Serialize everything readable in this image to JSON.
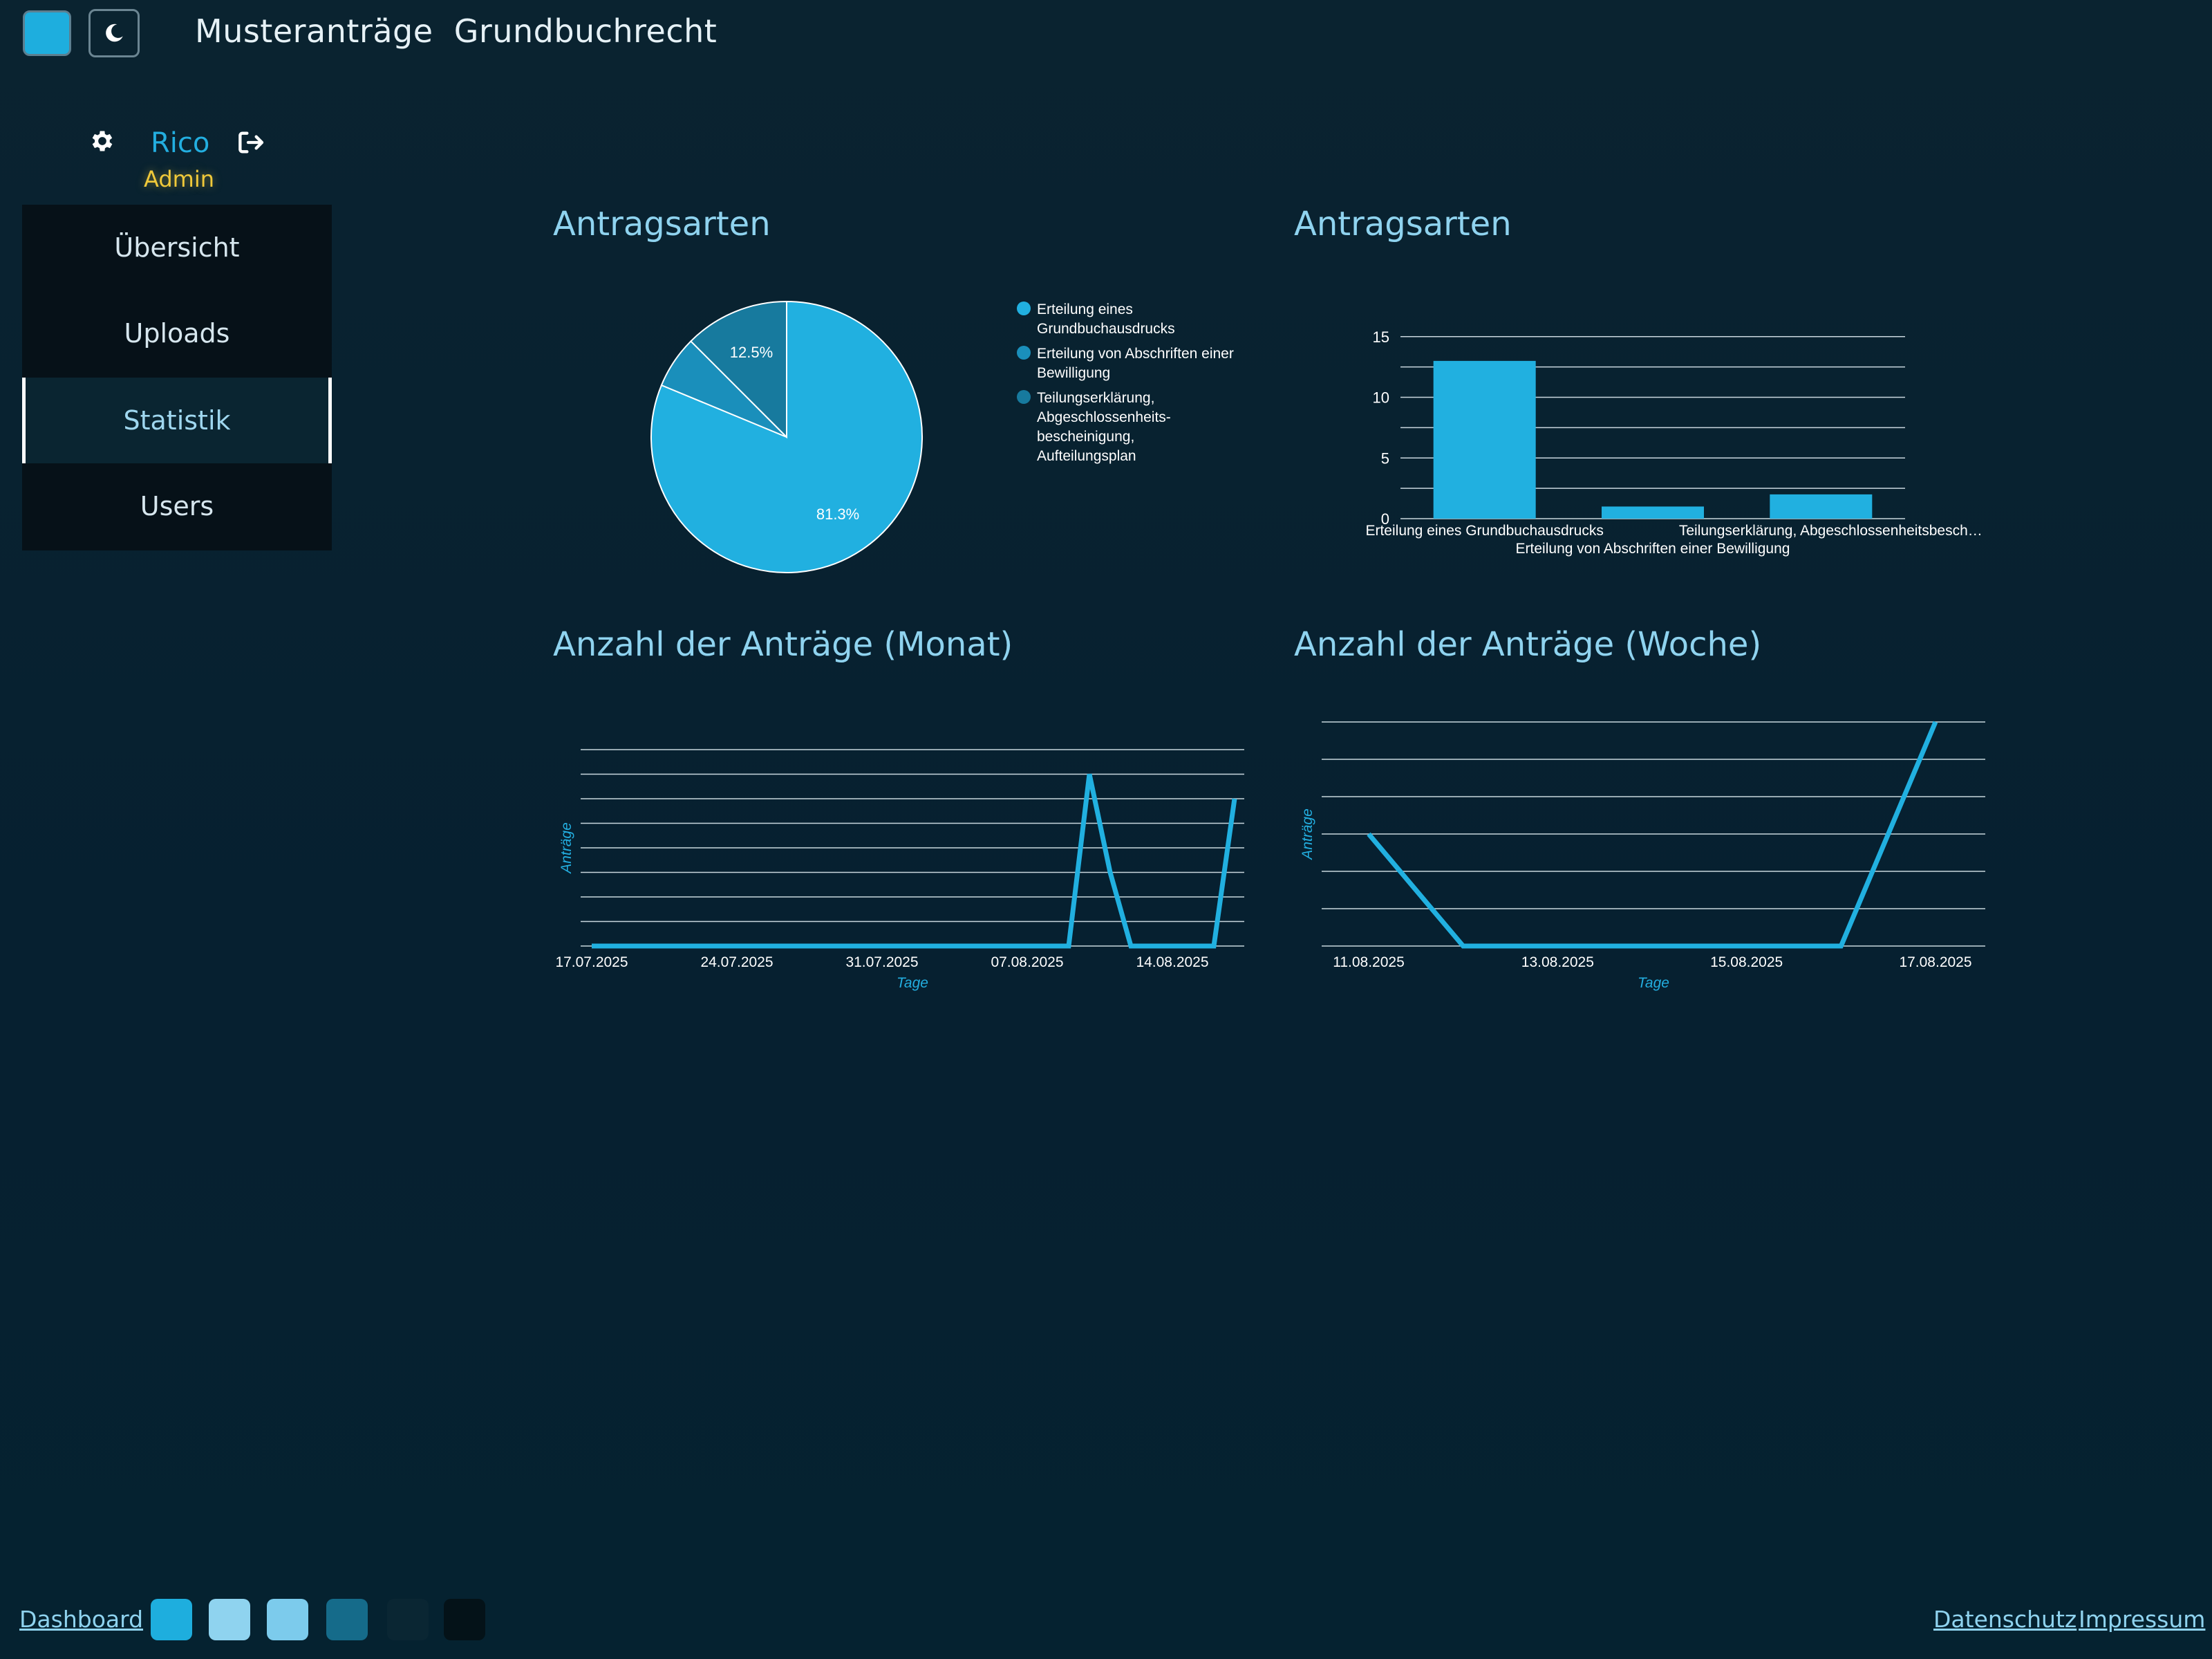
{
  "header": {
    "title": "Musteranträge  Grundbuchrecht",
    "theme_square_color": "#1eaede",
    "moon_icon": "moon-icon"
  },
  "user": {
    "name": "Rico",
    "role": "Admin",
    "settings_icon": "gear-icon",
    "logout_icon": "logout-icon"
  },
  "sidebar": {
    "items": [
      {
        "label": "Übersicht",
        "active": false
      },
      {
        "label": "Uploads",
        "active": false
      },
      {
        "label": "Statistik",
        "active": true
      },
      {
        "label": "Users",
        "active": false
      }
    ]
  },
  "panels": {
    "pie_title": "Antragsarten",
    "bar_title": "Antragsarten",
    "month_title": "Anzahl der Anträge (Monat)",
    "week_title": "Anzahl der Anträge (Woche)"
  },
  "chart_data": [
    {
      "type": "pie",
      "title": "Antragsarten",
      "categories": [
        "Erteilung eines Grundbuchausdrucks",
        "Erteilung von Abschriften einer Bewilligung",
        "Teilungserklärung, Abgeschlossenheits-bescheinigung, Aufteilungsplan"
      ],
      "legend_lines": [
        [
          "Erteilung eines",
          "Grundbuchausdrucks"
        ],
        [
          "Erteilung von Abschriften einer",
          "Bewilligung"
        ],
        [
          "Teilungserklärung,",
          "Abgeschlossenheits-",
          "bescheinigung,",
          "Aufteilungsplan"
        ]
      ],
      "values": [
        81.25,
        6.25,
        12.5
      ],
      "data_labels": [
        "81.3%",
        "",
        "12.5%"
      ],
      "colors": [
        "#21b0e0",
        "#1a8fbb",
        "#177a9e"
      ],
      "legend": "right"
    },
    {
      "type": "bar",
      "title": "Antragsarten",
      "categories": [
        "Erteilung eines Grundbuchausdrucks",
        "Erteilung von Abschriften einer Bewilligung",
        "Teilungserklärung, Abgeschlossenheitsbesch…"
      ],
      "values": [
        13,
        1,
        2
      ],
      "yticks": [
        0,
        5,
        10,
        15
      ],
      "ylim": [
        0,
        15.5
      ],
      "grid": true,
      "color": "#21b0e0"
    },
    {
      "type": "line",
      "title": "Anzahl der Anträge (Monat)",
      "xlabel": "Tage",
      "ylabel": "Anträge",
      "xticks": [
        "17.07.2025",
        "24.07.2025",
        "31.07.2025",
        "07.08.2025",
        "14.08.2025"
      ],
      "x": [
        "17.07.2025",
        "18.07.2025",
        "19.07.2025",
        "20.07.2025",
        "21.07.2025",
        "22.07.2025",
        "23.07.2025",
        "24.07.2025",
        "25.07.2025",
        "26.07.2025",
        "27.07.2025",
        "28.07.2025",
        "29.07.2025",
        "30.07.2025",
        "31.07.2025",
        "01.08.2025",
        "02.08.2025",
        "03.08.2025",
        "04.08.2025",
        "05.08.2025",
        "06.08.2025",
        "07.08.2025",
        "08.08.2025",
        "09.08.2025",
        "10.08.2025",
        "11.08.2025",
        "12.08.2025",
        "13.08.2025",
        "14.08.2025",
        "15.08.2025",
        "16.08.2025",
        "17.08.2025"
      ],
      "values": [
        0,
        0,
        0,
        0,
        0,
        0,
        0,
        0,
        0,
        0,
        0,
        0,
        0,
        0,
        0,
        0,
        0,
        0,
        0,
        0,
        0,
        0,
        0,
        0,
        7,
        3,
        0,
        0,
        0,
        0,
        0,
        6
      ],
      "ylim": [
        0,
        8
      ],
      "grid": true,
      "color": "#21b0e0"
    },
    {
      "type": "line",
      "title": "Anzahl der Anträge (Woche)",
      "xlabel": "Tage",
      "ylabel": "Anträge",
      "xticks": [
        "11.08.2025",
        "13.08.2025",
        "15.08.2025",
        "17.08.2025"
      ],
      "x": [
        "11.08.2025",
        "12.08.2025",
        "13.08.2025",
        "14.08.2025",
        "15.08.2025",
        "16.08.2025",
        "17.08.2025"
      ],
      "values": [
        3,
        0,
        0,
        0,
        0,
        0,
        6
      ],
      "ylim": [
        0,
        6
      ],
      "grid": true,
      "color": "#21b0e0"
    }
  ],
  "footer": {
    "dashboard_label": "Dashboard",
    "datenschutz_label": "Datenschutz",
    "impressum_label": "Impressum",
    "swatches": [
      "#1eaede",
      "#8fd3ef",
      "#7ccbec",
      "#156b8a",
      "#0a2633",
      "#041218"
    ]
  }
}
